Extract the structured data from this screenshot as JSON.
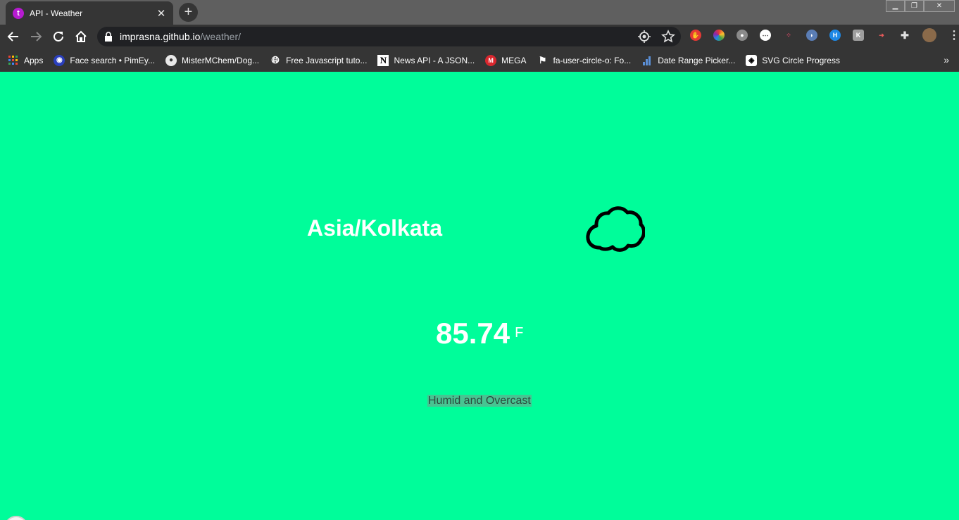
{
  "browser": {
    "tab": {
      "title": "API - Weather",
      "favicon": "t"
    },
    "url": {
      "host": "imprasna.github.io",
      "path": "/weather/"
    },
    "window_controls": [
      "minimize",
      "restore",
      "close"
    ]
  },
  "bookmarks": [
    {
      "label": "Apps",
      "icon": "apps-grid-icon",
      "color": "#ea4335"
    },
    {
      "label": "Face search • PimEy...",
      "icon": "pimeyes-icon",
      "color": "#3b5bdb"
    },
    {
      "label": "MisterMChem/Dog...",
      "icon": "github-icon",
      "color": "#ffffff"
    },
    {
      "label": "Free Javascript tuto...",
      "icon": "globe-icon",
      "color": "#ffffff"
    },
    {
      "label": "News API - A JSON...",
      "icon": "newsapi-icon",
      "color": "#000000"
    },
    {
      "label": "MEGA",
      "icon": "mega-icon",
      "color": "#d9272e"
    },
    {
      "label": "fa-user-circle-o: Fo...",
      "icon": "flag-icon",
      "color": "#ffffff"
    },
    {
      "label": "Date Range Picker...",
      "icon": "bar-chart-icon",
      "color": "#5b8fd6"
    },
    {
      "label": "SVG Circle Progress",
      "icon": "codepen-icon",
      "color": "#ffffff"
    }
  ],
  "weather": {
    "location": "Asia/Kolkata",
    "temperature": "85.74",
    "unit": "F",
    "summary": "Humid and Overcast",
    "icon": "cloud-icon"
  },
  "colors": {
    "background": "#00fd9a",
    "text": "#ffffff",
    "icon_stroke": "#000000"
  }
}
